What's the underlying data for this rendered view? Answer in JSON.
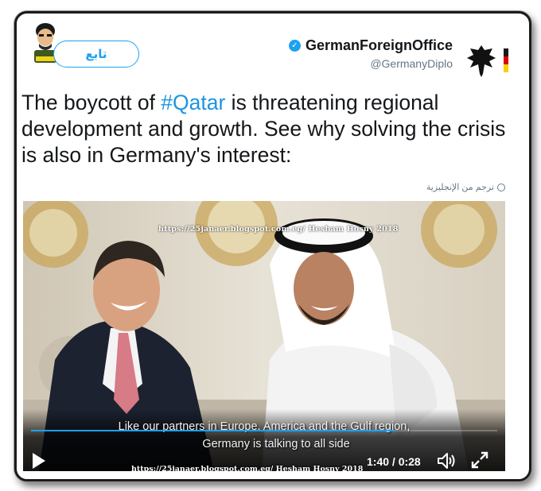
{
  "follow_button": {
    "label": "تابع"
  },
  "account": {
    "display_name": "GermanForeignOffice",
    "handle": "@GermanyDiplo",
    "verified_icon": "verified-badge-icon"
  },
  "tweet": {
    "text_part1": "The boycott of ",
    "hashtag": "#Qatar",
    "text_part2": " is threatening regional development and growth.  See why solving the crisis is also in Germany's interest:"
  },
  "translate": {
    "label": "ترجم من الإنجليزية",
    "icon": "globe-icon"
  },
  "video": {
    "watermark_top": "https://25janaer.blogspot.com.eg/ Hesham Hosny 2018",
    "subtitle_line1": "Like our partners in Europe, America and the Gulf region,",
    "subtitle_line2": "Germany is talking to all side",
    "time": "1:40 / 0:28",
    "watermark_bottom": "https://25janaer.blogspot.com.eg/  Hesham Hosny 2018",
    "progress": 0.78
  },
  "colors": {
    "accent": "#1da1f2",
    "hashtag": "#1b95e0"
  }
}
